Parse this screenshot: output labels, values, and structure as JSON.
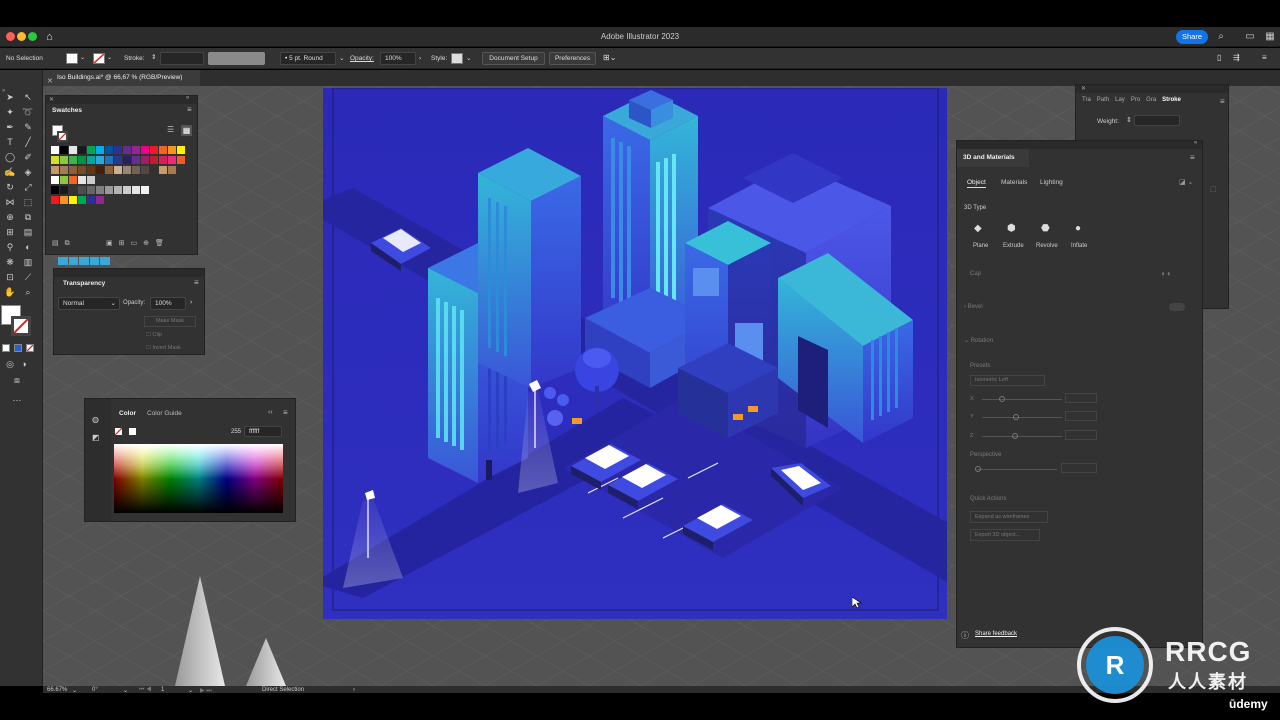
{
  "app": {
    "title": "Adobe Illustrator 2023",
    "share_label": "Share"
  },
  "control_bar": {
    "selection_label": "No Selection",
    "stroke_label": "Stroke:",
    "brush_label": "5 pt. Round",
    "opacity_label": "Opacity:",
    "opacity_value": "100%",
    "style_label": "Style:",
    "document_setup_label": "Document Setup",
    "preferences_label": "Preferences"
  },
  "document_tab": {
    "title": "Iso Buildings.ai* @ 66,67 % (RGB/Preview)"
  },
  "swatches_panel": {
    "title": "Swatches",
    "colors": {
      "row1": [
        "#ffffff",
        "#000000",
        "#e6e6e6",
        "#1a1a1a",
        "#00a651",
        "#00aeef",
        "#0054a6",
        "#2e3192",
        "#662d91",
        "#92278f",
        "#ec008c",
        "#ed1c24",
        "#f26522",
        "#f7941d",
        "#fff200"
      ],
      "row2": [
        "#d7df23",
        "#8dc63f",
        "#39b54a",
        "#009444",
        "#00a79d",
        "#27aae1",
        "#1c75bc",
        "#2b388f",
        "#262262",
        "#652d90",
        "#9e1f63",
        "#be1e2d",
        "#da1c5c",
        "#ee2a7b",
        "#f15a29"
      ],
      "row3": [
        "#c49a6c",
        "#a67c52",
        "#8b5e3c",
        "#754c24",
        "#603913",
        "#42210b",
        "#8c6239",
        "#c7b299",
        "#998675",
        "#736357",
        "#534741",
        "#362f2d",
        "#c69c6d",
        "#a57c52"
      ],
      "row4": [
        "#ffffff",
        "#8dc63f",
        "#f26522",
        "#e6e6e6",
        "#cccccc"
      ],
      "row5": [
        "#000000",
        "#1a1a1a",
        "#333333",
        "#4d4d4d",
        "#666666",
        "#808080",
        "#999999",
        "#b3b3b3",
        "#cccccc",
        "#e6e6e6",
        "#f2f2f2"
      ],
      "row6": [
        "#ed1c24",
        "#f7941d",
        "#fff200",
        "#00a651",
        "#2e3192",
        "#92278f"
      ]
    }
  },
  "transparency_panel": {
    "title": "Transparency",
    "blend_mode": "Normal",
    "opacity_label": "Opacity:",
    "opacity_value": "100%",
    "make_mask": "Make Mask",
    "clip": "Clip",
    "invert_mask": "Invert Mask"
  },
  "color_panel": {
    "tab_color": "Color",
    "tab_color_guide": "Color Guide",
    "value": "255",
    "hex": "ffffff"
  },
  "right_mini_panel": {
    "tabs": [
      "Tra",
      "Path",
      "Lay",
      "Pro",
      "Gra",
      "Stroke"
    ],
    "weight_label": "Weight:"
  },
  "materials_panel": {
    "title": "3D and Materials",
    "tabs": [
      "Object",
      "Materials",
      "Lighting"
    ],
    "type_label": "3D Type",
    "types": [
      "Plane",
      "Extrude",
      "Revolve",
      "Inflate"
    ],
    "cap_label": "Cap",
    "bevel_label": "Bevel",
    "rotation_label": "Rotation",
    "presets_label": "Presets",
    "preset_value": "Isometric Left",
    "axis_x": "X",
    "axis_y": "Y",
    "axis_z": "Z",
    "perspective_label": "Perspective",
    "quick_actions_label": "Quick Actions",
    "expand_label": "Expand as wireframes",
    "export_label": "Export 3D object...",
    "feedback_label": "Share feedback"
  },
  "status_bar": {
    "zoom": "66.67%",
    "rotation": "0°",
    "artboard_num": "1",
    "tool_name": "Direct Selection"
  },
  "watermark": {
    "brand": "RRCG",
    "subtitle": "人人素材",
    "udemy": "ūdemy"
  },
  "colors": {
    "artboard": "#2b2bb0",
    "accent": "#1473e6"
  }
}
